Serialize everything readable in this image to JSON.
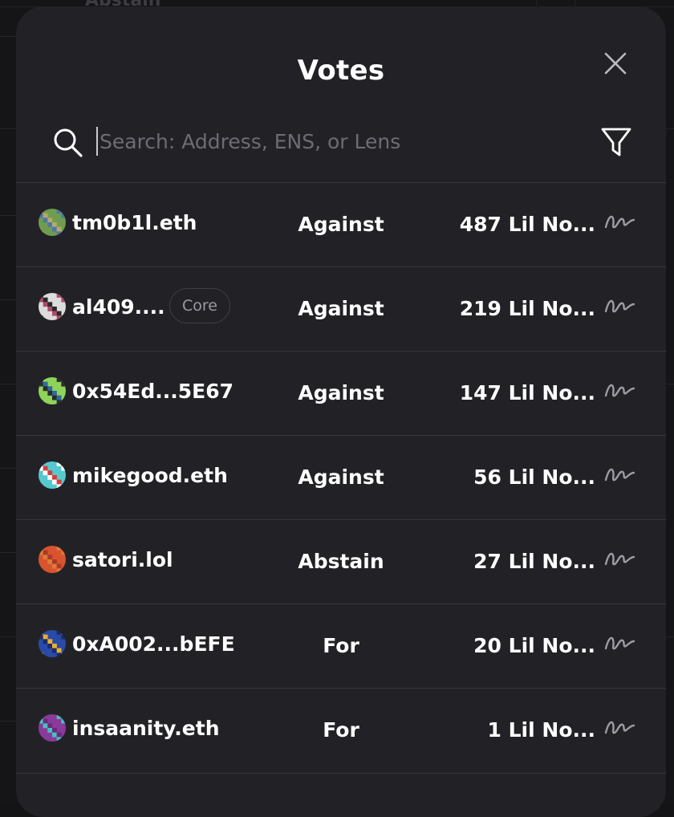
{
  "background": {
    "partial_text": "Abstain"
  },
  "modal": {
    "title": "Votes",
    "search": {
      "placeholder": "Search: Address, ENS, or Lens",
      "value": ""
    }
  },
  "votes": [
    {
      "voter": "tm0b1l.eth",
      "badge": "",
      "choice": "Against",
      "amount": "487 Lil No...",
      "avatar_colors": [
        "#6f9c4f",
        "#b8a86a",
        "#4a78a8"
      ]
    },
    {
      "voter": "al409....",
      "badge": "Core",
      "choice": "Against",
      "amount": "219 Lil No...",
      "avatar_colors": [
        "#dcdcdc",
        "#2a2a2e",
        "#b04a6a"
      ]
    },
    {
      "voter": "0x54Ed...5E67",
      "badge": "",
      "choice": "Against",
      "amount": "147 Lil No...",
      "avatar_colors": [
        "#8fd35a",
        "#2e6a9a",
        "#2a2a2e"
      ]
    },
    {
      "voter": "mikegood.eth",
      "badge": "",
      "choice": "Against",
      "amount": "56 Lil No...",
      "avatar_colors": [
        "#55c8d0",
        "#d93a3a",
        "#ffffff"
      ]
    },
    {
      "voter": "satori.lol",
      "badge": "",
      "choice": "Abstain",
      "amount": "27 Lil No...",
      "avatar_colors": [
        "#d8542e",
        "#a83a2a",
        "#e07a3a"
      ]
    },
    {
      "voter": "0xA002...bEFE",
      "badge": "",
      "choice": "For",
      "amount": "20 Lil No...",
      "avatar_colors": [
        "#2a4aa8",
        "#e8b030",
        "#1a2a6a"
      ]
    },
    {
      "voter": "insaanity.eth",
      "badge": "",
      "choice": "For",
      "amount": "1 Lil No...",
      "avatar_colors": [
        "#8a3a9a",
        "#6a2a7a",
        "#4ac0c0"
      ]
    }
  ]
}
